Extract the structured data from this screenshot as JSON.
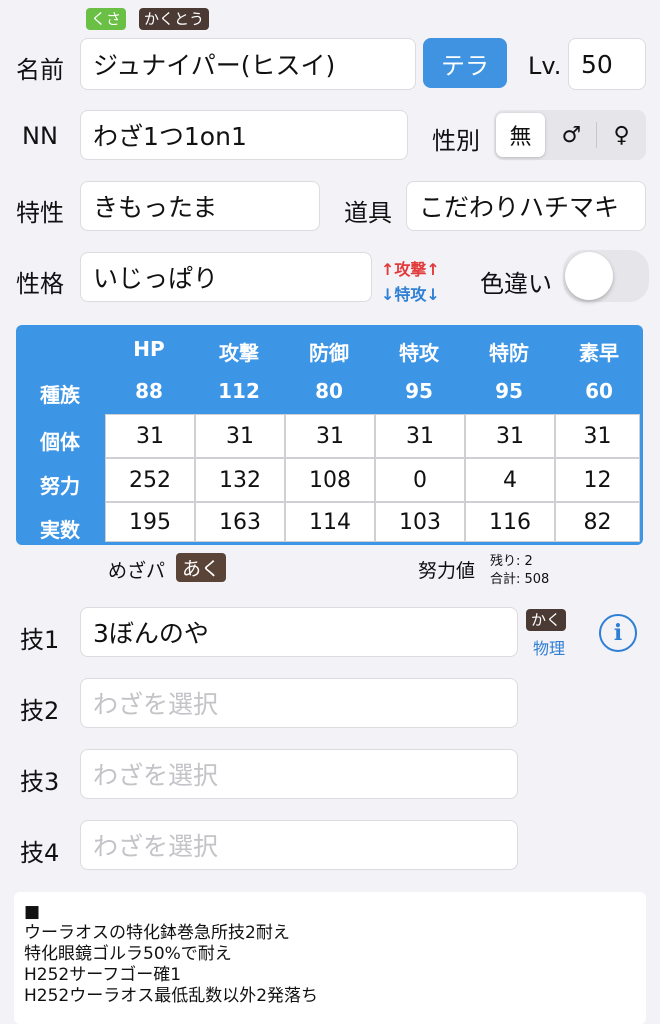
{
  "types": [
    {
      "label": "くさ",
      "color": "#6abf45"
    },
    {
      "label": "かくとう",
      "color": "#4a3a33"
    }
  ],
  "name": {
    "label": "名前",
    "value": "ジュナイパー(ヒスイ)"
  },
  "tera_button": "テラ",
  "level": {
    "label": "Lv.",
    "value": "50"
  },
  "nickname": {
    "label": "NN",
    "value": "わざ1つ1on1"
  },
  "gender": {
    "label": "性別",
    "options": [
      "無",
      "♂",
      "♀"
    ],
    "selected": "無"
  },
  "ability": {
    "label": "特性",
    "value": "きもったま"
  },
  "item": {
    "label": "道具",
    "value": "こだわりハチマキ"
  },
  "nature": {
    "label": "性格",
    "value": "いじっぱり",
    "up": "↑攻撃↑",
    "down": "↓特攻↓"
  },
  "shiny": {
    "label": "色違い",
    "on": false
  },
  "stats": {
    "headers": [
      "HP",
      "攻撃",
      "防御",
      "特攻",
      "特防",
      "素早"
    ],
    "row_labels": {
      "base": "種族",
      "iv": "個体",
      "ev": "努力",
      "actual": "実数"
    },
    "base": [
      "88",
      "112",
      "80",
      "95",
      "95",
      "60"
    ],
    "iv": [
      "31",
      "31",
      "31",
      "31",
      "31",
      "31"
    ],
    "ev": [
      "252",
      "132",
      "108",
      "0",
      "4",
      "12"
    ],
    "actual": [
      "195",
      "163",
      "114",
      "103",
      "116",
      "82"
    ]
  },
  "hidden_power": {
    "label": "めざパ",
    "type": "あく"
  },
  "ev_summary": {
    "label": "努力値",
    "remaining": "残り: 2",
    "total": "合計: 508"
  },
  "moves": [
    {
      "label": "技1",
      "value": "3ぼんのや",
      "placeholder": "",
      "type": "かく",
      "category": "物理"
    },
    {
      "label": "技2",
      "value": "",
      "placeholder": "わざを選択"
    },
    {
      "label": "技3",
      "value": "",
      "placeholder": "わざを選択"
    },
    {
      "label": "技4",
      "value": "",
      "placeholder": "わざを選択"
    }
  ],
  "memo": [
    "■",
    "ウーラオスの特化鉢巻急所技2耐え",
    "特化眼鏡ゴルラ50%で耐え",
    "H252サーフゴー確1",
    "H252ウーラオス最低乱数以外2発落ち"
  ],
  "colors": {
    "accent": "#3f93e0",
    "grass": "#6abf45",
    "fighting": "#4a3a33",
    "nature_up": "#e23b3b",
    "nature_down": "#2f7fd4"
  }
}
